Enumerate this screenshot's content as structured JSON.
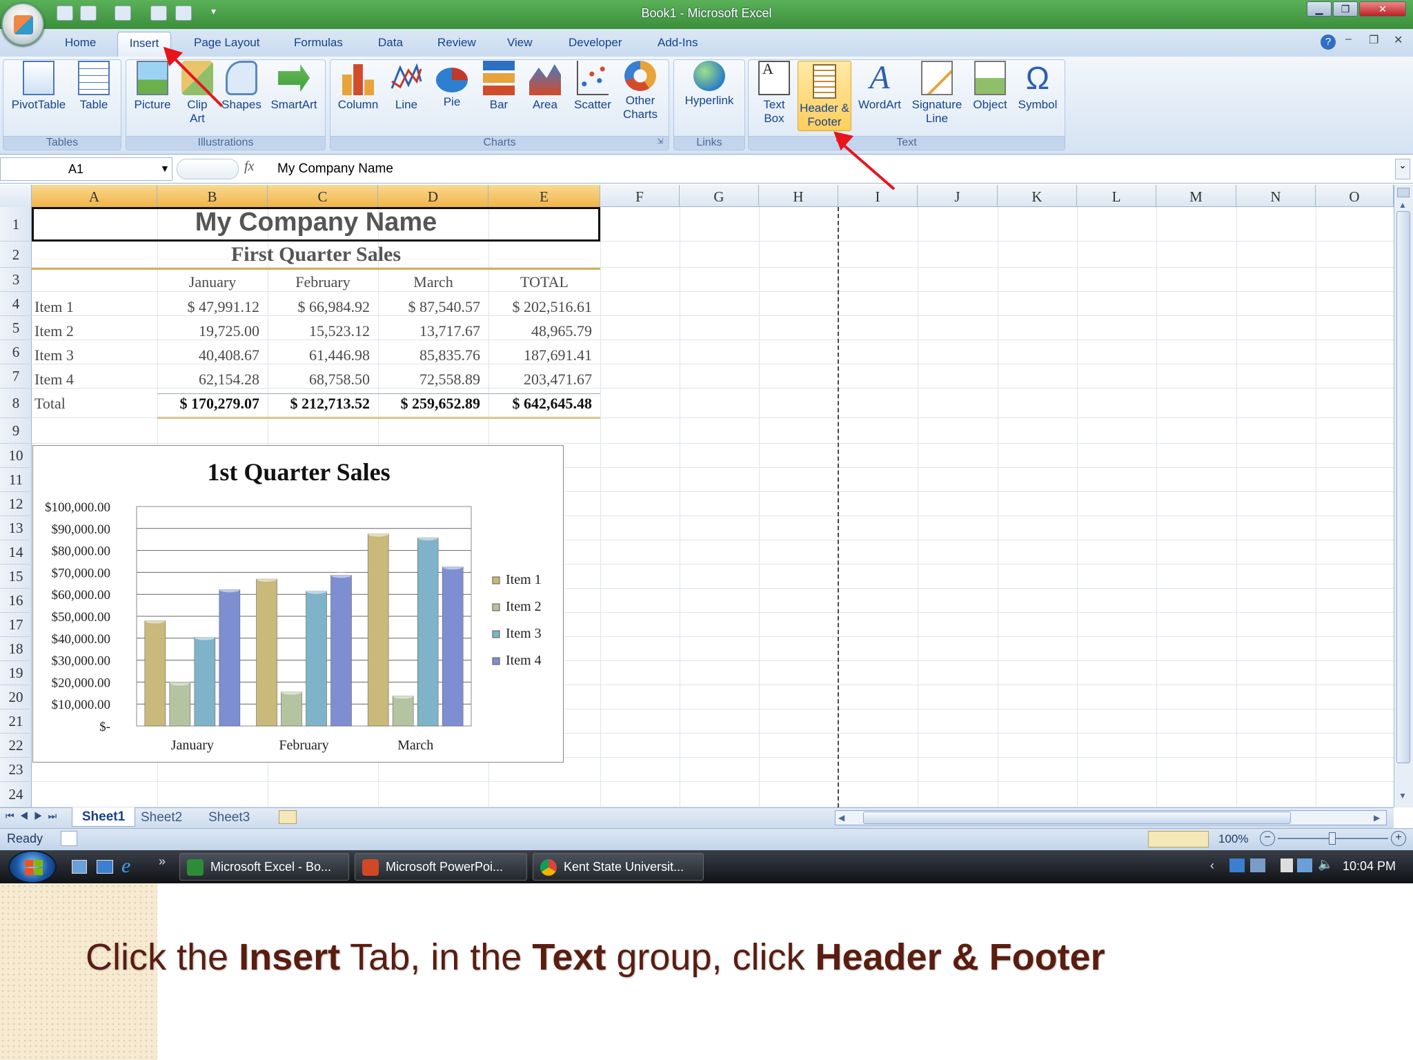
{
  "window": {
    "title": "Book1 - Microsoft Excel"
  },
  "ribbon": {
    "tabs": [
      "Home",
      "Insert",
      "Page Layout",
      "Formulas",
      "Data",
      "Review",
      "View",
      "Developer",
      "Add-Ins"
    ],
    "groups": {
      "tables": {
        "label": "Tables",
        "buttons": [
          "PivotTable",
          "Table"
        ]
      },
      "illustrations": {
        "label": "Illustrations",
        "buttons": [
          "Picture",
          "Clip Art",
          "Shapes",
          "SmartArt"
        ]
      },
      "charts": {
        "label": "Charts",
        "buttons": [
          "Column",
          "Line",
          "Pie",
          "Bar",
          "Area",
          "Scatter",
          "Other Charts"
        ]
      },
      "links": {
        "label": "Links",
        "buttons": [
          "Hyperlink"
        ]
      },
      "text": {
        "label": "Text",
        "buttons": [
          "Text Box",
          "Header & Footer",
          "WordArt",
          "Signature Line",
          "Object",
          "Symbol"
        ]
      }
    }
  },
  "formula_bar": {
    "name_box": "A1",
    "fx": "fx",
    "value": "My Company Name"
  },
  "columns": [
    "A",
    "B",
    "C",
    "D",
    "E",
    "F",
    "G",
    "H",
    "I",
    "J",
    "K",
    "L",
    "M",
    "N",
    "O"
  ],
  "rows": [
    "1",
    "2",
    "3",
    "4",
    "5",
    "6",
    "7",
    "8",
    "9",
    "10",
    "11",
    "12",
    "13",
    "14",
    "15",
    "16",
    "17",
    "18",
    "19",
    "20",
    "21",
    "22",
    "23",
    "24"
  ],
  "sheet": {
    "title": "My Company Name",
    "subtitle": "First Quarter Sales",
    "headers": [
      "January",
      "February",
      "March",
      "TOTAL"
    ],
    "rows": [
      {
        "label": "Item 1",
        "values": [
          "$  47,991.12",
          "$  66,984.92",
          "$  87,540.57",
          "$ 202,516.61"
        ]
      },
      {
        "label": "Item 2",
        "values": [
          "19,725.00",
          "15,523.12",
          "13,717.67",
          "48,965.79"
        ]
      },
      {
        "label": "Item 3",
        "values": [
          "40,408.67",
          "61,446.98",
          "85,835.76",
          "187,691.41"
        ]
      },
      {
        "label": "Item 4",
        "values": [
          "62,154.28",
          "68,758.50",
          "72,558.89",
          "203,471.67"
        ]
      }
    ],
    "total": {
      "label": "Total",
      "values": [
        "$ 170,279.07",
        "$ 212,713.52",
        "$ 259,652.89",
        "$ 642,645.48"
      ]
    }
  },
  "chart_data": {
    "type": "bar",
    "title": "1st Quarter Sales",
    "categories": [
      "January",
      "February",
      "March"
    ],
    "series": [
      {
        "name": "Item 1",
        "values": [
          47991.12,
          66984.92,
          87540.57
        ],
        "color": "#c9b97a"
      },
      {
        "name": "Item 2",
        "values": [
          19725.0,
          15523.12,
          13717.67
        ],
        "color": "#b5c4a0"
      },
      {
        "name": "Item 3",
        "values": [
          40408.67,
          61446.98,
          85835.76
        ],
        "color": "#7fb3c9"
      },
      {
        "name": "Item 4",
        "values": [
          62154.28,
          68758.5,
          72558.89
        ],
        "color": "#7d8fd1"
      }
    ],
    "yticks": [
      "$100,000.00",
      "$90,000.00",
      "$80,000.00",
      "$70,000.00",
      "$60,000.00",
      "$50,000.00",
      "$40,000.00",
      "$30,000.00",
      "$20,000.00",
      "$10,000.00",
      "$-"
    ],
    "ylim": [
      0,
      100000
    ],
    "grid": true,
    "legend": "right"
  },
  "sheet_tabs": [
    "Sheet1",
    "Sheet2",
    "Sheet3"
  ],
  "status": {
    "ready": "Ready",
    "zoom": "100%"
  },
  "taskbar": {
    "items": [
      "Microsoft Excel - Bo...",
      "Microsoft PowerPoi...",
      "Kent State Universit..."
    ],
    "clock": "10:04 PM"
  },
  "caption": {
    "p1": "Click the ",
    "b1": "Insert",
    "p2": " Tab, in the ",
    "b2": "Text",
    "p3": " group, click ",
    "b3": "Header & Footer"
  },
  "colors": {
    "title_bar": "#4a9f48",
    "ribbon_blue": "#15428b",
    "highlight": "#ffce5c",
    "arrow": "#e8141b",
    "caption": "#5a1d10"
  }
}
